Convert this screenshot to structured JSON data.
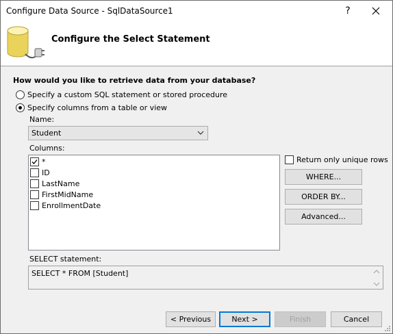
{
  "window": {
    "title": "Configure Data Source - SqlDataSource1",
    "help_glyph": "?"
  },
  "header": {
    "title": "Configure the Select Statement"
  },
  "question": "How would you like to retrieve data from your database?",
  "options": {
    "custom_sql": {
      "label": "Specify a custom SQL statement or stored procedure",
      "selected": false
    },
    "columns": {
      "label": "Specify columns from a table or view",
      "selected": true
    }
  },
  "name_field": {
    "label": "Name:",
    "value": "Student"
  },
  "columns": {
    "label": "Columns:",
    "items": [
      {
        "label": "*",
        "checked": true
      },
      {
        "label": "ID",
        "checked": false
      },
      {
        "label": "LastName",
        "checked": false
      },
      {
        "label": "FirstMidName",
        "checked": false
      },
      {
        "label": "EnrollmentDate",
        "checked": false
      }
    ]
  },
  "unique_rows": {
    "label": "Return only unique rows",
    "checked": false
  },
  "side_buttons": {
    "where": "WHERE...",
    "order_by": "ORDER BY...",
    "advanced": "Advanced..."
  },
  "select_statement": {
    "label": "SELECT statement:",
    "value": "SELECT * FROM [Student]"
  },
  "footer": {
    "previous": "< Previous",
    "next": "Next >",
    "finish": "Finish",
    "cancel": "Cancel"
  },
  "colors": {
    "accent": "#0078d7",
    "dialog_bg": "#f0f0f0",
    "header_bg": "#ffffff"
  },
  "icons": {
    "header": "database-plug-icon",
    "close": "close-icon",
    "dropdown": "chevron-down-icon"
  }
}
